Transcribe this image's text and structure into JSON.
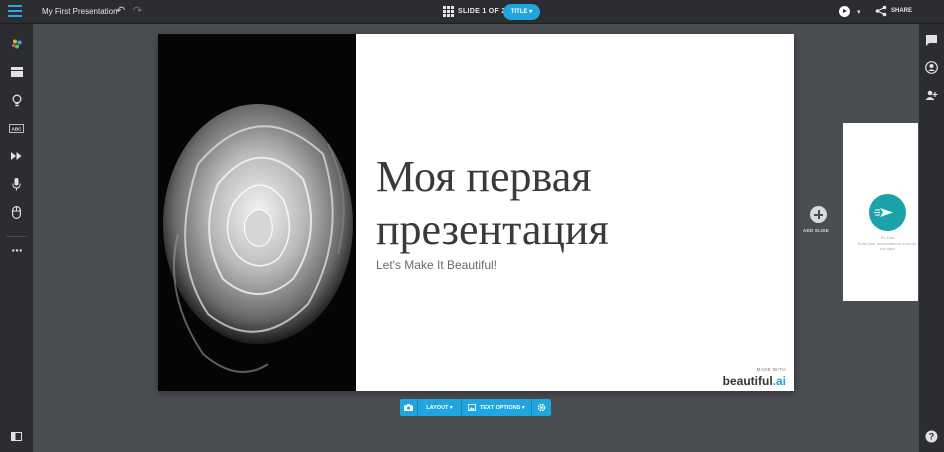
{
  "app": {
    "title": "My First Presentation"
  },
  "header": {
    "slide_counter": "SLIDE 1 OF 2",
    "title_pill": "TITLE ▾",
    "play_caret": "▾",
    "share_label": "SHARE"
  },
  "slide": {
    "heading": "Моя первая презентация",
    "subtitle": "Let's Make It Beautiful!",
    "made_with": "MADE WITH",
    "brand_name": "beautiful",
    "brand_suffix": ".ai"
  },
  "add_slide": {
    "label": "ADD SLIDE"
  },
  "next_slide": {
    "text1": "It's Fast",
    "text2": "Build your presentations in hours, not days"
  },
  "toolbar": {
    "layout_label": "LAYOUT ▾",
    "text_options_label": "TEXT OPTIONS ▾"
  },
  "colors": {
    "accent": "#1fa5e0",
    "teal": "#1aa3a8",
    "chrome": "#2b2d30",
    "canvas": "#4a4d52"
  },
  "icons": {
    "left_sidebar": [
      "palette-icon",
      "layout-icon",
      "lightbulb-icon",
      "abc-icon",
      "fast-forward-icon",
      "microphone-icon",
      "mouse-icon",
      "more-icon",
      "panel-icon"
    ],
    "right_sidebar": [
      "comment-icon",
      "user-icon",
      "add-user-icon",
      "help-icon"
    ]
  }
}
